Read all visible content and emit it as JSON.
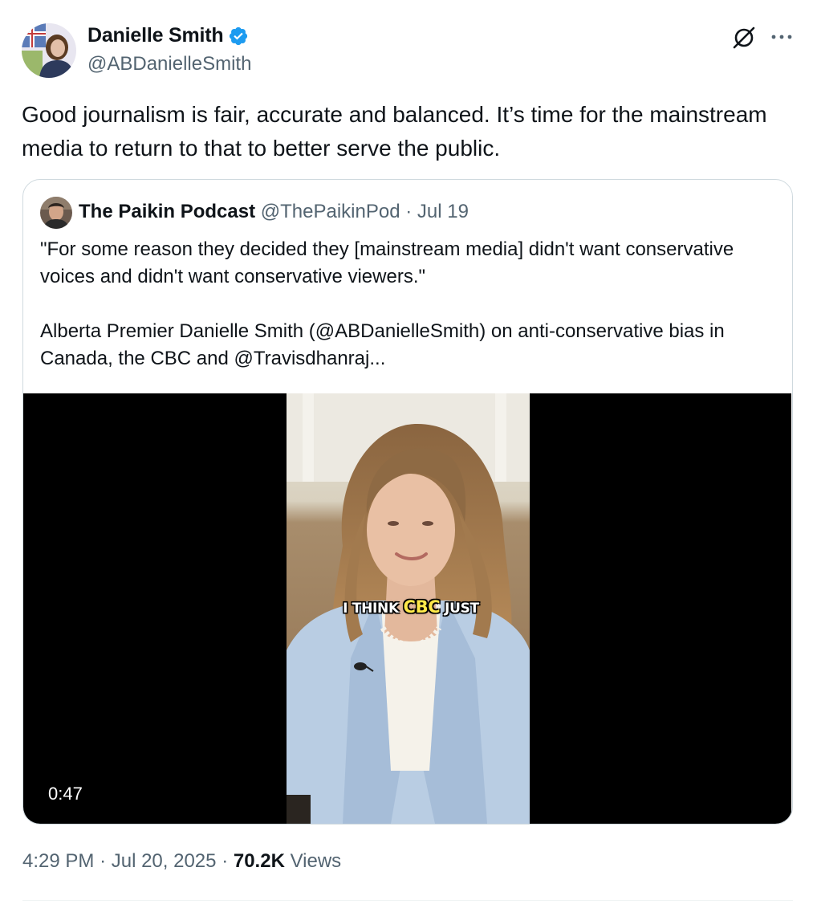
{
  "author": {
    "display_name": "Danielle Smith",
    "handle": "@ABDanielleSmith",
    "verified": true
  },
  "tweet": {
    "text": "Good journalism is fair, accurate and balanced.  It’s time for the mainstream media to return to that to better serve the public."
  },
  "quote": {
    "display_name": "The Paikin Podcast",
    "handle": "@ThePaikinPod",
    "separator": "·",
    "date": "Jul 19",
    "paragraphs": [
      "\"For some reason they decided they [mainstream media] didn't want conservative voices and didn't want conservative viewers.\"",
      "Alberta Premier Danielle Smith (@ABDanielleSmith) on anti-conservative bias in Canada, the CBC and @Travisdhanraj..."
    ],
    "video": {
      "duration": "0:47",
      "caption_before": "I THINK",
      "caption_highlight": "CBC",
      "caption_after": "JUST"
    }
  },
  "footer": {
    "time": "4:29 PM",
    "dot1": "·",
    "date": "Jul 20, 2025",
    "dot2": "·",
    "views_count": "70.2K",
    "views_label": "Views"
  },
  "icons": {
    "verified": "verified-badge-icon",
    "grok": "grok-icon",
    "more": "more-icon"
  },
  "colors": {
    "verified_blue": "#1d9bf0",
    "text_primary": "#0f1419",
    "text_secondary": "#536471",
    "border": "#cfd9de",
    "caption_highlight": "#ffe94a"
  }
}
